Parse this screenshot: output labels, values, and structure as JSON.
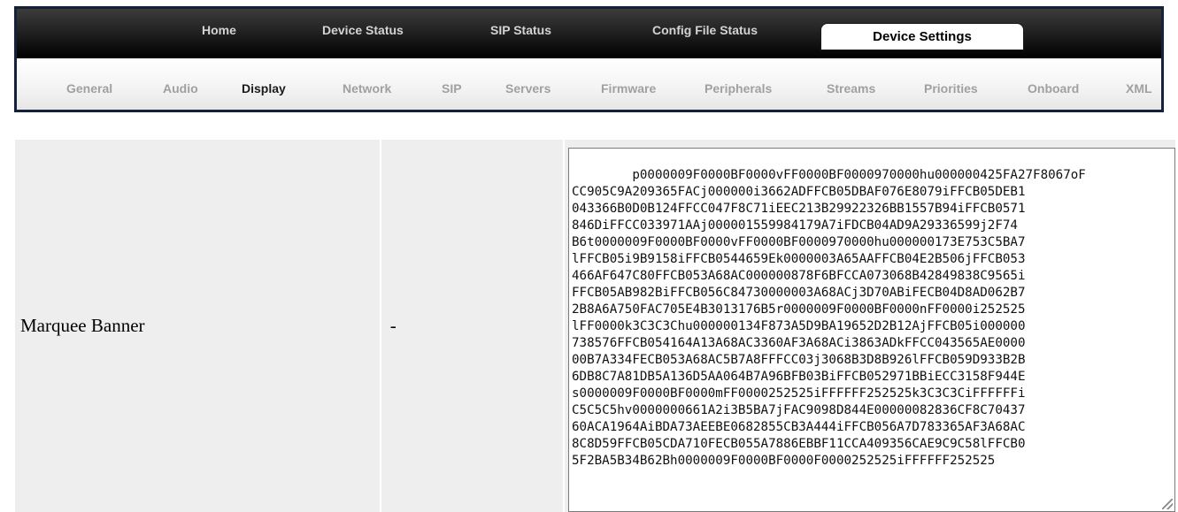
{
  "top_nav": [
    {
      "label": "Home"
    },
    {
      "label": "Device Status"
    },
    {
      "label": "SIP Status"
    },
    {
      "label": "Config File Status"
    },
    {
      "label": "Device Settings",
      "active": true
    }
  ],
  "sub_nav": [
    {
      "label": "General"
    },
    {
      "label": "Audio"
    },
    {
      "label": "Display",
      "active": true
    },
    {
      "label": "Network"
    },
    {
      "label": "SIP"
    },
    {
      "label": "Servers"
    },
    {
      "label": "Firmware"
    },
    {
      "label": "Peripherals"
    },
    {
      "label": "Streams"
    },
    {
      "label": "Priorities"
    },
    {
      "label": "Onboard"
    },
    {
      "label": "XML"
    }
  ],
  "setting": {
    "name": "Marquee Banner",
    "default": "-",
    "value_lines": [
      "p0000009F0000BF0000vFF0000BF0000970000hu000000425FA27F8067oF",
      "CC905C9A209365FACj000000i3662ADFFCB05DBAF076E8079iFFCB05DEB1",
      "043366B0D0B124FFCC047F8C71iEEC213B29922326BB1557B94iFFCB0571",
      "846DiFFCC033971AAj000001559984179A7iFDCB04AD9A29336599j2F74",
      "B6t0000009F0000BF0000vFF0000BF0000970000hu000000173E753C5BA7",
      "lFFCB05i9B9158iFFCB0544659Ek0000003A65AAFFCB04E2B506jFFCB053",
      "466AF647C80FFCB053A68AC000000878F6BFCCA073068B42849838C9565i",
      "FFCB05AB982BiFFCB056C84730000003A68ACj3D70ABiFECB04D8AD062B7",
      "2B8A6A750FAC705E4B3013176B5r0000009F0000BF0000nFF0000i252525",
      "lFF0000k3C3C3Chu000000134F873A5D9BA19652D2B12AjFFCB05i000000",
      "738576FFCB054164A13A68AC3360AF3A68ACi3863ADkFFCC043565AE0000",
      "00B7A334FECB053A68AC5B7A8FFFCC03j3068B3D8B926lFFCB059D933B2B",
      "6DB8C7A81DB5A136D5AA064B7A96BFB03BiFFCB052971BBiECC3158F944E",
      "s0000009F0000BF0000mFF0000252525iFFFFFF252525k3C3C3CiFFFFFFi",
      "C5C5C5hv0000000661A2i3B5BA7jFAC9098D844E00000082836CF8C70437",
      "60ACA1964AiBDA73AEEBE0682855CB3A444iFFCB056A7D783365AF3A68AC",
      "8C8D59FFCB05CDA710FECB055A7886EBBF11CCA409356CAE9C9C58lFFCB0",
      "5F2BA5B34B62Bh0000009F0000BF0000F0000252525iFFFFFF252525"
    ]
  },
  "colors": {
    "top_nav_border": "#14213a",
    "top_nav_text": "#d3d3d3",
    "sub_nav_text": "#a0a0a0",
    "sub_nav_active": "#1b1b1b",
    "row_background": "#eeeeee"
  }
}
